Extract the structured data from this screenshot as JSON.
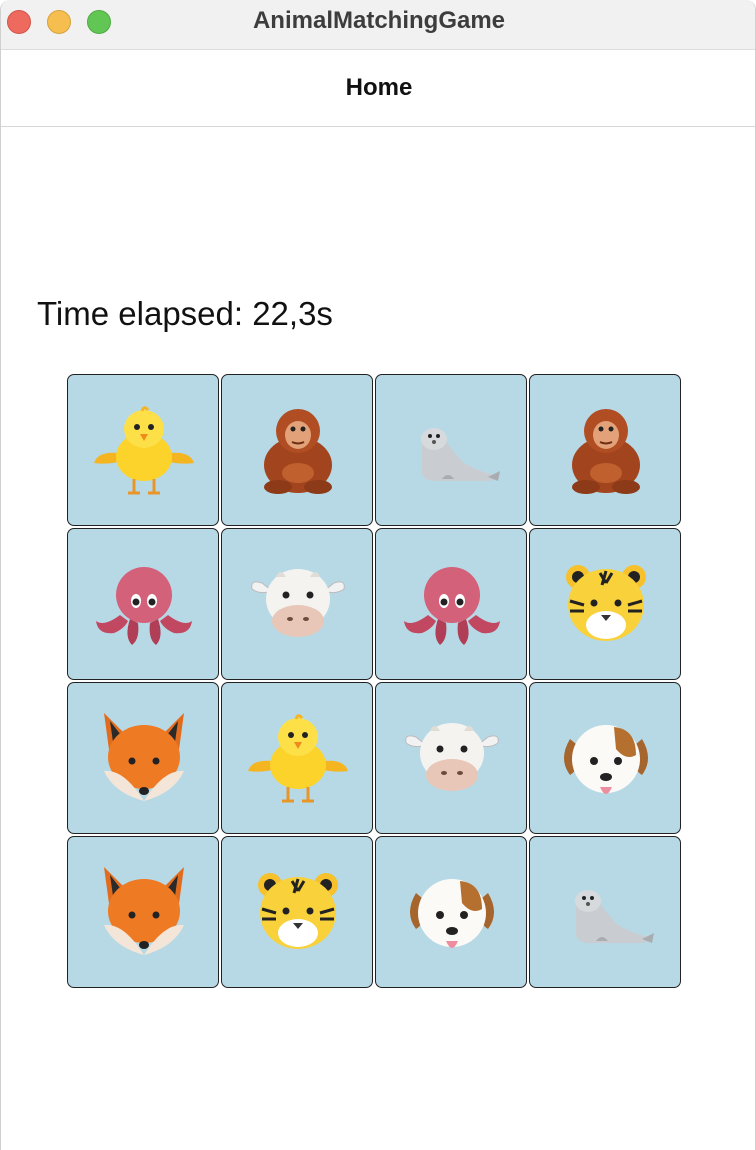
{
  "window": {
    "title": "AnimalMatchingGame"
  },
  "nav": {
    "title": "Home"
  },
  "game": {
    "timer_text": "Time elapsed: 22,3s",
    "card_background": "#b7d9e6",
    "cards": [
      {
        "animal": "chick-icon"
      },
      {
        "animal": "orangutan-icon"
      },
      {
        "animal": "seal-icon"
      },
      {
        "animal": "orangutan-icon"
      },
      {
        "animal": "octopus-icon"
      },
      {
        "animal": "cow-icon"
      },
      {
        "animal": "octopus-icon"
      },
      {
        "animal": "tiger-icon"
      },
      {
        "animal": "fox-icon"
      },
      {
        "animal": "chick-icon"
      },
      {
        "animal": "cow-icon"
      },
      {
        "animal": "dog-icon"
      },
      {
        "animal": "fox-icon"
      },
      {
        "animal": "tiger-icon"
      },
      {
        "animal": "dog-icon"
      },
      {
        "animal": "seal-icon"
      }
    ]
  }
}
